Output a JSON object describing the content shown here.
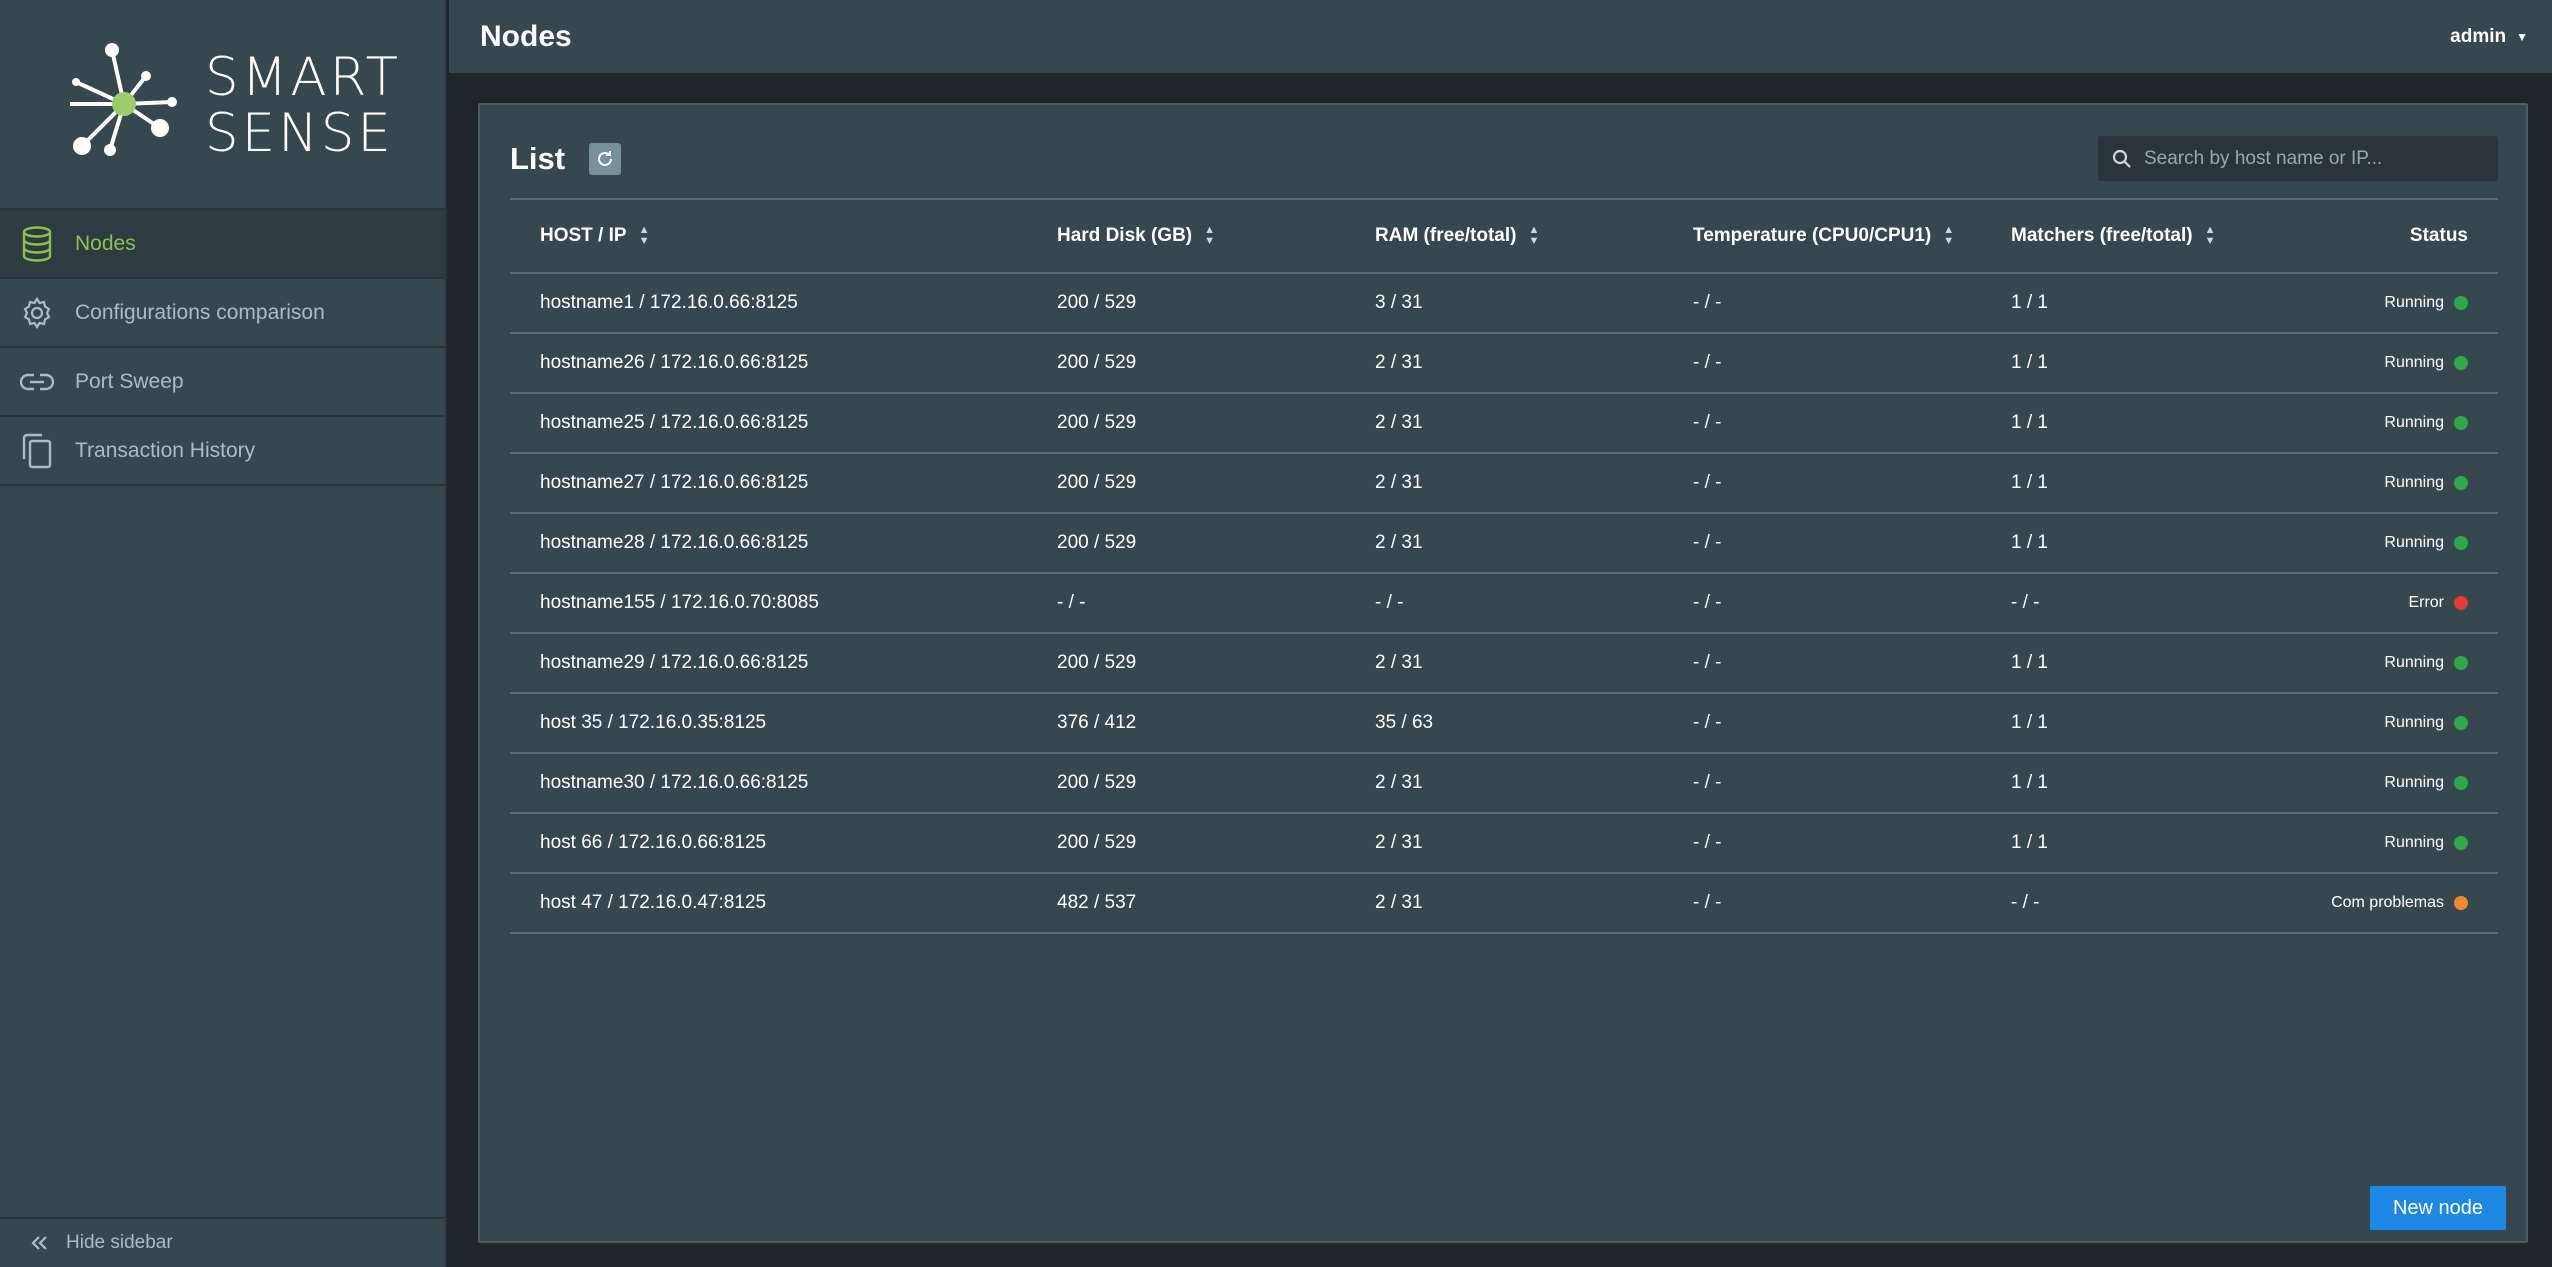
{
  "app": {
    "logo_line1": "SMART",
    "logo_line2": "SENSE"
  },
  "sidebar": {
    "items": [
      {
        "label": "Nodes",
        "icon": "database-icon",
        "active": true
      },
      {
        "label": "Configurations comparison",
        "icon": "gear-icon",
        "active": false
      },
      {
        "label": "Port Sweep",
        "icon": "link-icon",
        "active": false
      },
      {
        "label": "Transaction History",
        "icon": "copy-icon",
        "active": false
      }
    ],
    "hide_label": "Hide sidebar"
  },
  "header": {
    "title": "Nodes",
    "user": "admin"
  },
  "panel": {
    "title": "List",
    "search_placeholder": "Search by host name or IP...",
    "new_node_label": "New node"
  },
  "table": {
    "columns": [
      "HOST / IP",
      "Hard Disk (GB)",
      "RAM (free/total)",
      "Temperature (CPU0/CPU1)",
      "Matchers (free/total)",
      "Status"
    ],
    "rows": [
      {
        "host": "hostname1 / 172.16.0.66:8125",
        "disk": "200 / 529",
        "ram": "3 / 31",
        "temp": "- / -",
        "matchers": "1 / 1",
        "status": "Running",
        "status_color": "#2ea84a"
      },
      {
        "host": "hostname26 / 172.16.0.66:8125",
        "disk": "200 / 529",
        "ram": "2 / 31",
        "temp": "- / -",
        "matchers": "1 / 1",
        "status": "Running",
        "status_color": "#2ea84a"
      },
      {
        "host": "hostname25 / 172.16.0.66:8125",
        "disk": "200 / 529",
        "ram": "2 / 31",
        "temp": "- / -",
        "matchers": "1 / 1",
        "status": "Running",
        "status_color": "#2ea84a"
      },
      {
        "host": "hostname27 / 172.16.0.66:8125",
        "disk": "200 / 529",
        "ram": "2 / 31",
        "temp": "- / -",
        "matchers": "1 / 1",
        "status": "Running",
        "status_color": "#2ea84a"
      },
      {
        "host": "hostname28 / 172.16.0.66:8125",
        "disk": "200 / 529",
        "ram": "2 / 31",
        "temp": "- / -",
        "matchers": "1 / 1",
        "status": "Running",
        "status_color": "#2ea84a"
      },
      {
        "host": "hostname155 / 172.16.0.70:8085",
        "disk": "- / -",
        "ram": "- / -",
        "temp": "- / -",
        "matchers": "- / -",
        "status": "Error",
        "status_color": "#e53935"
      },
      {
        "host": "hostname29 / 172.16.0.66:8125",
        "disk": "200 / 529",
        "ram": "2 / 31",
        "temp": "- / -",
        "matchers": "1 / 1",
        "status": "Running",
        "status_color": "#2ea84a"
      },
      {
        "host": "host 35 / 172.16.0.35:8125",
        "disk": "376 / 412",
        "ram": "35 / 63",
        "temp": "- / -",
        "matchers": "1 / 1",
        "status": "Running",
        "status_color": "#2ea84a"
      },
      {
        "host": "hostname30 / 172.16.0.66:8125",
        "disk": "200 / 529",
        "ram": "2 / 31",
        "temp": "- / -",
        "matchers": "1 / 1",
        "status": "Running",
        "status_color": "#2ea84a"
      },
      {
        "host": "host 66 / 172.16.0.66:8125",
        "disk": "200 / 529",
        "ram": "2 / 31",
        "temp": "- / -",
        "matchers": "1 / 1",
        "status": "Running",
        "status_color": "#2ea84a"
      },
      {
        "host": "host 47 / 172.16.0.47:8125",
        "disk": "482 / 537",
        "ram": "2 / 31",
        "temp": "- / -",
        "matchers": "- / -",
        "status": "Com problemas",
        "status_color": "#f0892b"
      }
    ]
  },
  "colors": {
    "accent_green": "#8bc34a",
    "primary_blue": "#1e88e5",
    "surface": "#37474f",
    "background": "#1f252b"
  }
}
